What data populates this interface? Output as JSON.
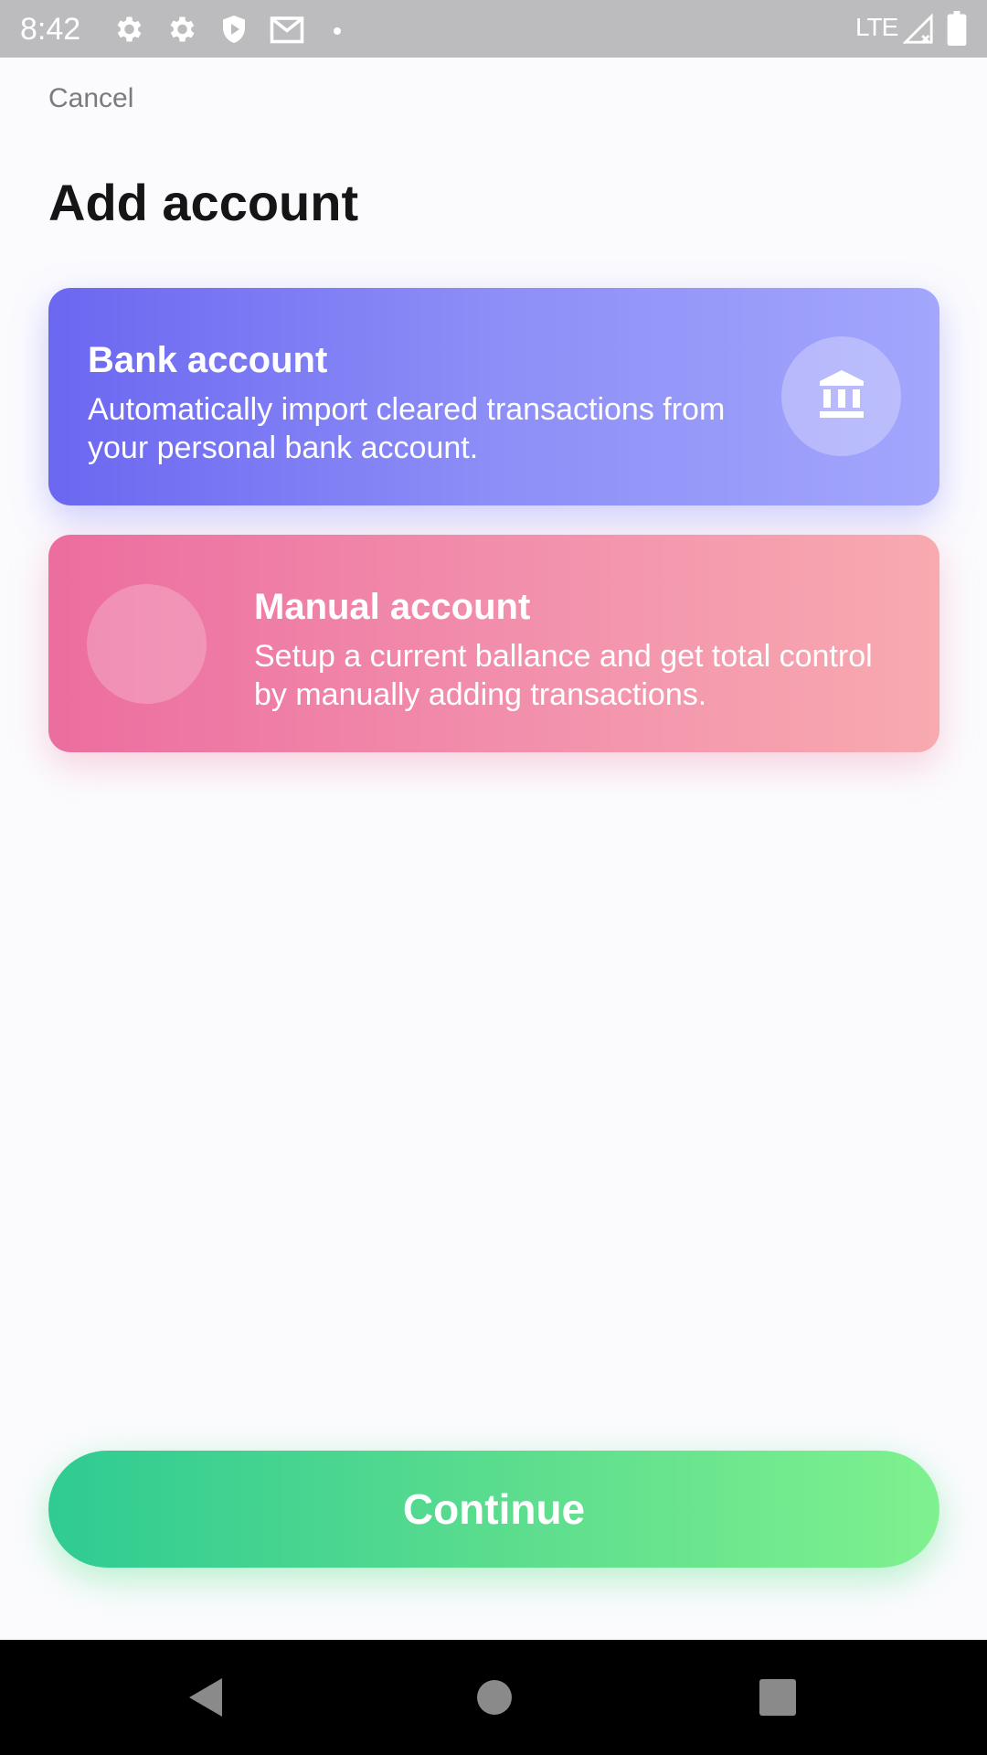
{
  "status_bar": {
    "time": "8:42",
    "network": "LTE",
    "icons": [
      "gear-icon",
      "gear-icon",
      "shield-play-icon",
      "mail-icon",
      "dot-icon",
      "signal-icon",
      "battery-icon"
    ]
  },
  "header": {
    "cancel_label": "Cancel",
    "title": "Add account"
  },
  "options": {
    "bank": {
      "title": "Bank account",
      "description": "Automatically import cleared transactions from your personal bank account.",
      "icon": "bank-icon",
      "color_start": "#6b67f1",
      "color_end": "#a3a6fc"
    },
    "manual": {
      "title": "Manual account",
      "description": "Setup a current ballance and get total control by manually adding transactions.",
      "color_start": "#ec6d9f",
      "color_end": "#f8aab0"
    }
  },
  "footer": {
    "continue_label": "Continue",
    "color_start": "#2fcb92",
    "color_end": "#7ff18f"
  },
  "nav_bar": {
    "icons": [
      "back-icon",
      "home-icon",
      "recents-icon"
    ]
  }
}
